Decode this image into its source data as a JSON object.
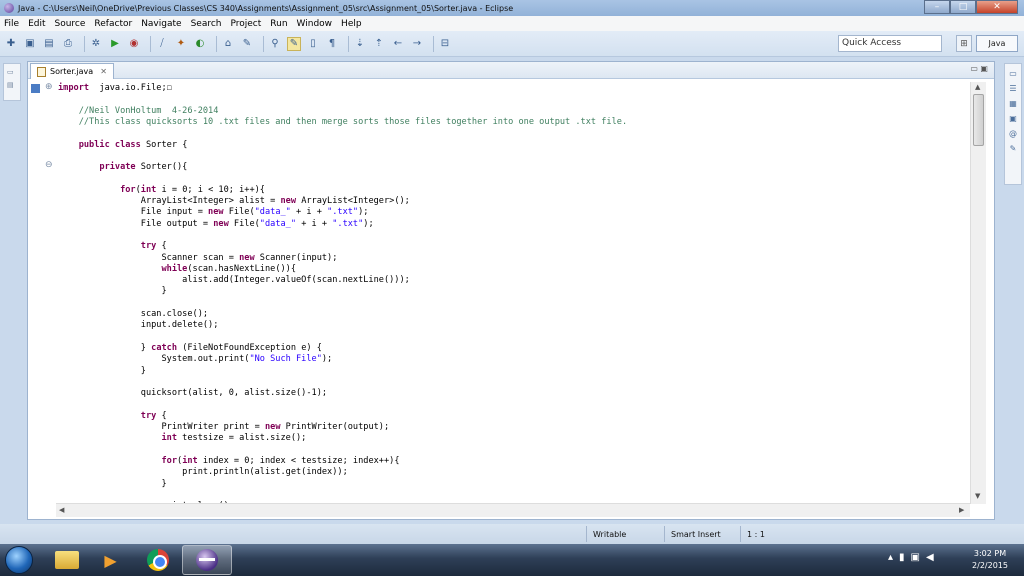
{
  "window": {
    "title": "Java - C:\\Users\\Neil\\OneDrive\\Previous Classes\\CS 340\\Assignments\\Assignment_05\\src\\Assignment_05\\Sorter.java - Eclipse",
    "minimize": "–",
    "maximize": "□",
    "close": "✕"
  },
  "menu": [
    "File",
    "Edit",
    "Source",
    "Refactor",
    "Navigate",
    "Search",
    "Project",
    "Run",
    "Window",
    "Help"
  ],
  "toolbar": {
    "quick_access_placeholder": "Quick Access",
    "perspective_label": "Java"
  },
  "editor": {
    "tab_label": "Sorter.java",
    "tab_close": "✕",
    "code_lines": [
      {
        "t": [
          [
            "kw",
            "import"
          ],
          [
            "",
            "  java.io.File;"
          ],
          [
            "",
            "☐"
          ]
        ]
      },
      {
        "t": [
          [
            "",
            ""
          ]
        ]
      },
      {
        "t": [
          [
            "cm",
            "    //Neil VonHoltum  4-26-2014"
          ]
        ]
      },
      {
        "t": [
          [
            "cm",
            "    //This class quicksorts 10 .txt files and then merge sorts those files together into one output .txt file."
          ]
        ]
      },
      {
        "t": [
          [
            "",
            ""
          ]
        ]
      },
      {
        "t": [
          [
            "kw",
            "    public class"
          ],
          [
            "",
            " Sorter {"
          ]
        ]
      },
      {
        "t": [
          [
            "",
            ""
          ]
        ]
      },
      {
        "t": [
          [
            "kw",
            "        private"
          ],
          [
            "",
            " Sorter(){"
          ]
        ]
      },
      {
        "t": [
          [
            "",
            ""
          ]
        ]
      },
      {
        "t": [
          [
            "kw",
            "            for"
          ],
          [
            "",
            "("
          ],
          [
            "kw",
            "int"
          ],
          [
            "",
            " i = 0; i < 10; i++){"
          ]
        ]
      },
      {
        "t": [
          [
            "",
            "                ArrayList<Integer> alist = "
          ],
          [
            "kw",
            "new"
          ],
          [
            "",
            " ArrayList<Integer>();"
          ]
        ]
      },
      {
        "t": [
          [
            "",
            "                File input = "
          ],
          [
            "kw",
            "new"
          ],
          [
            "",
            " File("
          ],
          [
            "st",
            "\"data_\""
          ],
          [
            "",
            " + i + "
          ],
          [
            "st",
            "\".txt\""
          ],
          [
            "",
            ");"
          ]
        ]
      },
      {
        "t": [
          [
            "",
            "                File output = "
          ],
          [
            "kw",
            "new"
          ],
          [
            "",
            " File("
          ],
          [
            "st",
            "\"data_\""
          ],
          [
            "",
            " + i + "
          ],
          [
            "st",
            "\".txt\""
          ],
          [
            "",
            ");"
          ]
        ]
      },
      {
        "t": [
          [
            "",
            ""
          ]
        ]
      },
      {
        "t": [
          [
            "kw",
            "                try"
          ],
          [
            "",
            " {"
          ]
        ]
      },
      {
        "t": [
          [
            "",
            "                    Scanner scan = "
          ],
          [
            "kw",
            "new"
          ],
          [
            "",
            " Scanner(input);"
          ]
        ]
      },
      {
        "t": [
          [
            "kw",
            "                    while"
          ],
          [
            "",
            "(scan.hasNextLine()){"
          ]
        ]
      },
      {
        "t": [
          [
            "",
            "                        alist.add(Integer.valueOf(scan.nextLine()));"
          ]
        ]
      },
      {
        "t": [
          [
            "",
            "                    }"
          ]
        ]
      },
      {
        "t": [
          [
            "",
            ""
          ]
        ]
      },
      {
        "t": [
          [
            "",
            "                scan.close();"
          ]
        ]
      },
      {
        "t": [
          [
            "",
            "                input.delete();"
          ]
        ]
      },
      {
        "t": [
          [
            "",
            ""
          ]
        ]
      },
      {
        "t": [
          [
            "",
            "                } "
          ],
          [
            "kw",
            "catch"
          ],
          [
            "",
            " (FileNotFoundException e) {"
          ]
        ]
      },
      {
        "t": [
          [
            "",
            "                    System.out.print("
          ],
          [
            "st",
            "\"No Such File\""
          ],
          [
            "",
            ");"
          ]
        ]
      },
      {
        "t": [
          [
            "",
            "                }"
          ]
        ]
      },
      {
        "t": [
          [
            "",
            ""
          ]
        ]
      },
      {
        "t": [
          [
            "",
            "                quicksort(alist, 0, alist.size()-1);"
          ]
        ]
      },
      {
        "t": [
          [
            "",
            ""
          ]
        ]
      },
      {
        "t": [
          [
            "kw",
            "                try"
          ],
          [
            "",
            " {"
          ]
        ]
      },
      {
        "t": [
          [
            "",
            "                    PrintWriter print = "
          ],
          [
            "kw",
            "new"
          ],
          [
            "",
            " PrintWriter(output);"
          ]
        ]
      },
      {
        "t": [
          [
            "kw",
            "                    int"
          ],
          [
            "",
            " testsize = alist.size();"
          ]
        ]
      },
      {
        "t": [
          [
            "",
            ""
          ]
        ]
      },
      {
        "t": [
          [
            "kw",
            "                    for"
          ],
          [
            "",
            "("
          ],
          [
            "kw",
            "int"
          ],
          [
            "",
            " index = 0; index < testsize; index++){"
          ]
        ]
      },
      {
        "t": [
          [
            "",
            "                        print.println(alist.get(index));"
          ]
        ]
      },
      {
        "t": [
          [
            "",
            "                    }"
          ]
        ]
      },
      {
        "t": [
          [
            "",
            ""
          ]
        ]
      },
      {
        "t": [
          [
            "",
            "                    print.close();"
          ]
        ]
      }
    ]
  },
  "status": {
    "writable": "Writable",
    "insert_mode": "Smart Insert",
    "position": "1 : 1"
  },
  "taskbar": {
    "time": "3:02 PM",
    "date": "2/2/2015"
  }
}
